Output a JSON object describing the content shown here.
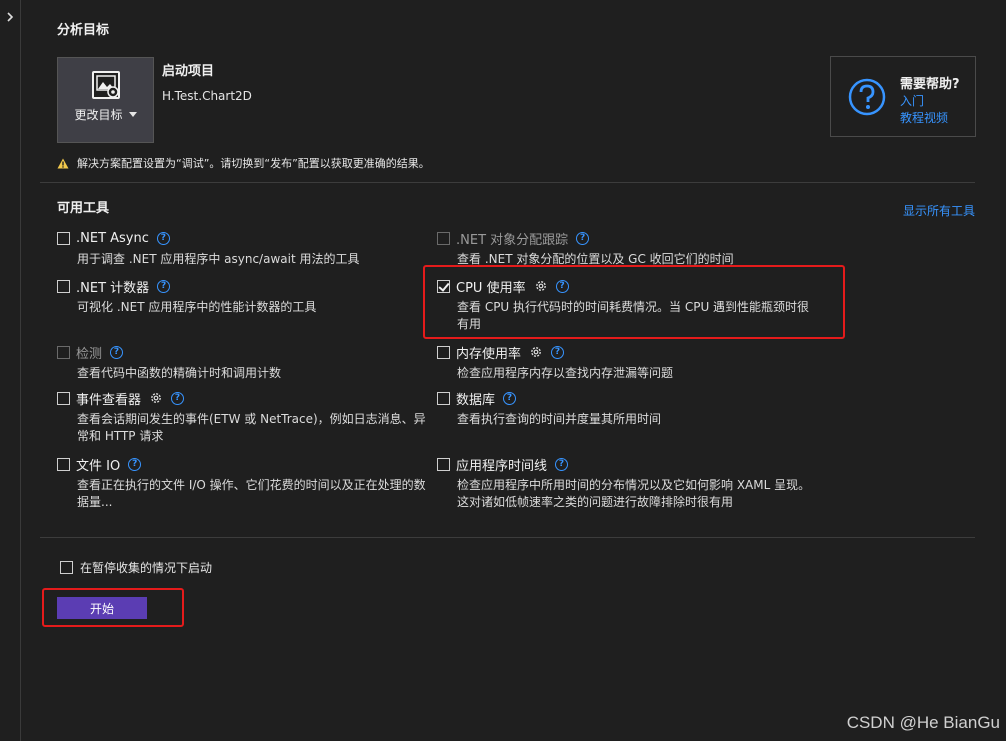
{
  "sections": {
    "analysis_target": "分析目标",
    "available_tools": "可用工具"
  },
  "target": {
    "change_label": "更改目标",
    "startup_title": "启动项目",
    "startup_value": "H.Test.Chart2D"
  },
  "help": {
    "title": "需要帮助?",
    "link_intro": "入门",
    "link_video": "教程视频"
  },
  "warning": "解决方案配置设置为“调试”。请切换到“发布”配置以获取更准确的结果。",
  "show_all": "显示所有工具",
  "tools": {
    "net_async": {
      "name": ".NET Async",
      "desc": "用于调查 .NET 应用程序中 async/await 用法的工具",
      "checked": false,
      "enabled": true
    },
    "net_alloc": {
      "name": ".NET 对象分配跟踪",
      "desc": "查看 .NET 对象分配的位置以及 GC 收回它们的时间",
      "checked": false,
      "enabled": false
    },
    "net_counters": {
      "name": ".NET 计数器",
      "desc": "可视化 .NET 应用程序中的性能计数器的工具",
      "checked": false,
      "enabled": true
    },
    "cpu": {
      "name": "CPU 使用率",
      "desc1": "查看 CPU 执行代码时的时间耗费情况。当 CPU 遇到性能瓶颈时很",
      "desc2": "有用",
      "checked": true,
      "enabled": true
    },
    "instrumentation": {
      "name": "检测",
      "desc": "查看代码中函数的精确计时和调用计数",
      "checked": false,
      "enabled": false
    },
    "memory": {
      "name": "内存使用率",
      "desc": "检查应用程序内存以查找内存泄漏等问题",
      "checked": false,
      "enabled": true
    },
    "events": {
      "name": "事件查看器",
      "desc1": "查看会话期间发生的事件(ETW 或 NetTrace)，例如日志消息、异",
      "desc2": "常和 HTTP 请求",
      "checked": false,
      "enabled": true
    },
    "database": {
      "name": "数据库",
      "desc": "查看执行查询的时间并度量其所用时间",
      "checked": false,
      "enabled": true
    },
    "file_io": {
      "name": "文件 IO",
      "desc1": "查看正在执行的文件 I/O 操作、它们花费的时间以及正在处理的数",
      "desc2": "据量...",
      "checked": false,
      "enabled": true
    },
    "timeline": {
      "name": "应用程序时间线",
      "desc1": "检查应用程序中所用时间的分布情况以及它如何影响 XAML 呈现。",
      "desc2": "这对诸如低帧速率之类的问题进行故障排除时很有用",
      "checked": false,
      "enabled": true
    }
  },
  "pause_label": "在暂停收集的情况下启动",
  "start_button": "开始",
  "watermark": "CSDN @He BianGu",
  "colors": {
    "accent_link": "#3794ff",
    "start_button": "#5b3db3",
    "annotation_red": "#e41b1b",
    "warning_yellow": "#f2c94c"
  }
}
